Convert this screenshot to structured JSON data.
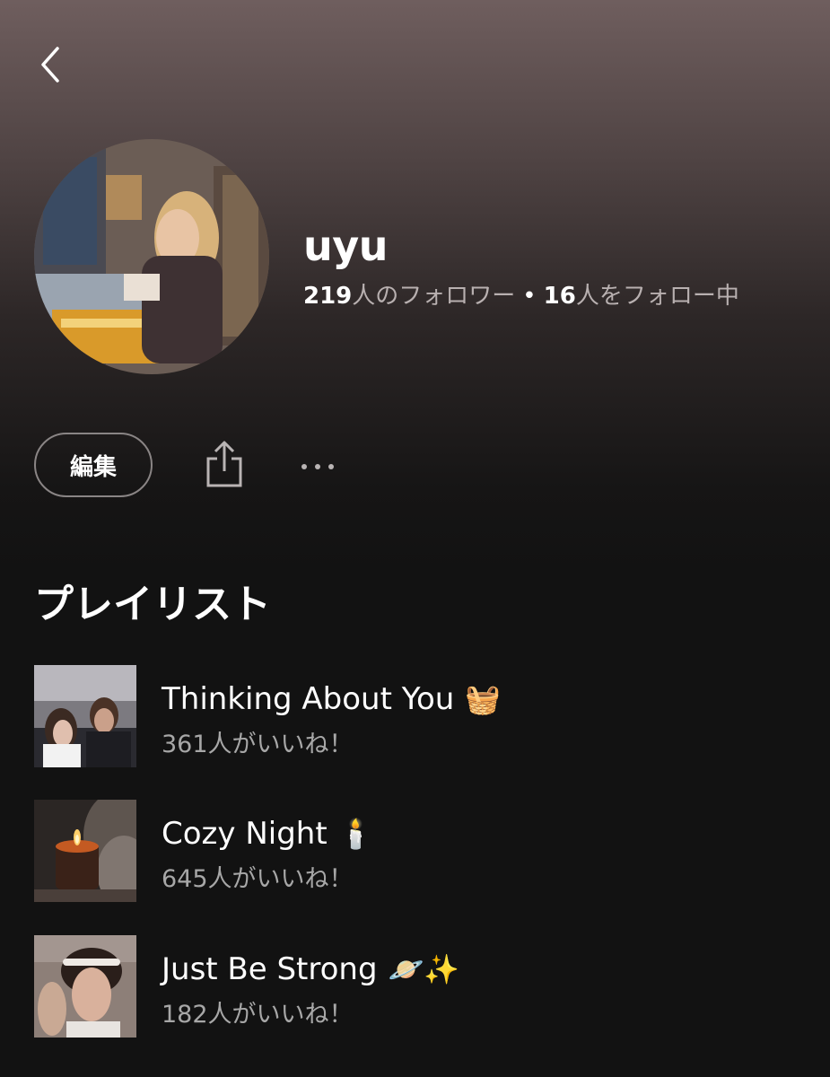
{
  "profile": {
    "username": "uyu",
    "followers_count": "219",
    "followers_label": "人のフォロワー",
    "separator": "•",
    "following_count": "16",
    "following_label": "人をフォロー中"
  },
  "actions": {
    "edit_label": "編集",
    "share_icon": "share-icon",
    "more_icon": "more-options-icon"
  },
  "navigation": {
    "back_icon": "chevron-left-icon"
  },
  "playlists_section": {
    "title": "プレイリスト",
    "items": [
      {
        "title": "Thinking About You",
        "emoji": "🧺",
        "likes": "361人がいいね！"
      },
      {
        "title": "Cozy Night",
        "emoji": "🕯️",
        "likes": "645人がいいね！"
      },
      {
        "title": "Just Be Strong",
        "emoji": "🪐✨",
        "likes": "182人がいいね！"
      }
    ]
  },
  "colors": {
    "background": "#121212",
    "header_top": "#6f5e5e",
    "secondary_text": "#a7a7a7",
    "primary_text": "#ffffff"
  }
}
